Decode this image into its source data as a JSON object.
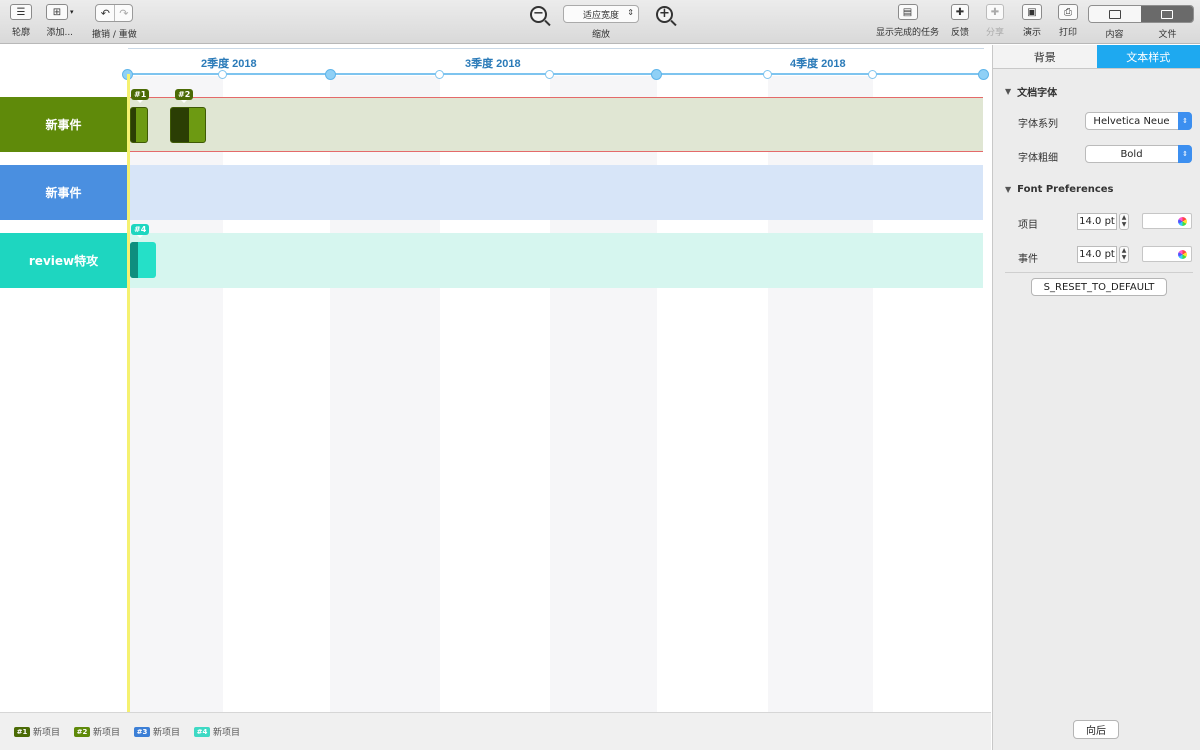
{
  "toolbar": {
    "outline_label": "轮廓",
    "add_label": "添加...",
    "undo_redo_label": "撤销 / 重做",
    "zoom_value": "适应宽度",
    "zoom_label": "缩放",
    "show_completed_label": "显示完成的任务",
    "feedback_label": "反馈",
    "share_label": "分享",
    "present_label": "演示",
    "print_label": "打印",
    "view_content_label": "内容",
    "view_file_label": "文件"
  },
  "timeline": {
    "quarters": [
      "2季度 2018",
      "3季度 2018",
      "4季度 2018"
    ],
    "lanes": [
      {
        "label": "新事件",
        "color": "#5f8a0a"
      },
      {
        "label": "新事件",
        "color": "#4a8fe0"
      },
      {
        "label": "review特攻",
        "color": "#1ed6c0"
      }
    ],
    "tasks": [
      {
        "tag": "#1",
        "color": "#4b6b06"
      },
      {
        "tag": "#2",
        "color": "#4b6b06"
      },
      {
        "tag": "#4",
        "color": "#1ed6c0"
      }
    ]
  },
  "legend": [
    {
      "tag": "#1",
      "label": "新项目",
      "color": "#4b6b06"
    },
    {
      "tag": "#2",
      "label": "新项目",
      "color": "#5f8a0a"
    },
    {
      "tag": "#3",
      "label": "新项目",
      "color": "#3c7fd6"
    },
    {
      "tag": "#4",
      "label": "新项目",
      "color": "#3ed9c4"
    }
  ],
  "inspector": {
    "tabs": [
      "背景",
      "文本样式"
    ],
    "doc_font_section": "文档字体",
    "font_family_label": "字体系列",
    "font_family_value": "Helvetica Neue",
    "font_weight_label": "字体粗细",
    "font_weight_value": "Bold",
    "font_pref_section": "Font Preferences",
    "item_label": "项目",
    "item_size": "14.0 pt",
    "event_label": "事件",
    "event_size": "14.0 pt",
    "reset_button": "S_RESET_TO_DEFAULT",
    "back_button": "向后"
  }
}
